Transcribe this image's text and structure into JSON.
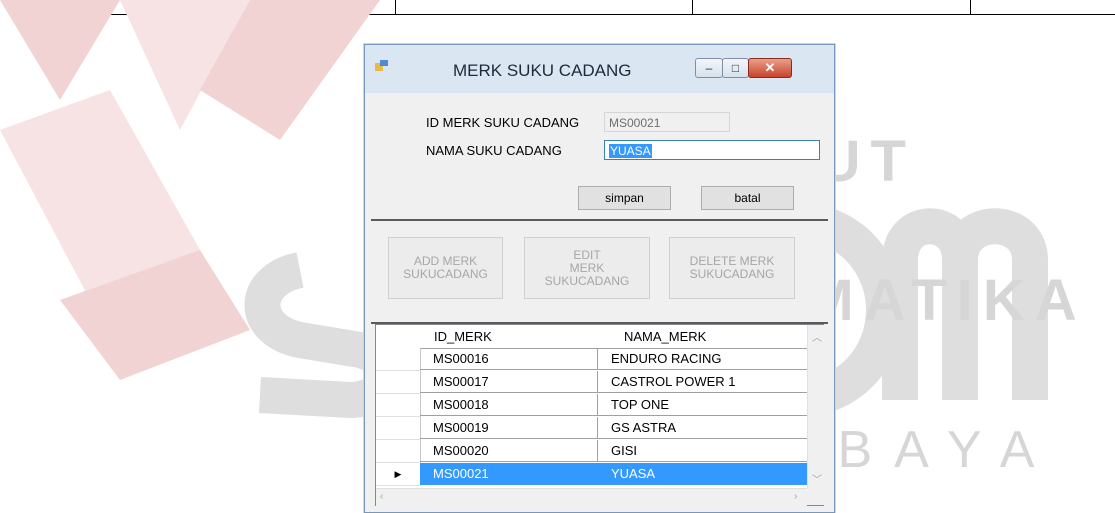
{
  "watermark": {
    "line1": "INSTITUT BISNIS",
    "line2": "& INFORMATIKA",
    "line3": "SURABAYA",
    "brand": "stikom"
  },
  "window": {
    "title": "MERK SUKU CADANG",
    "minimize_glyph": "–",
    "maximize_glyph": "□",
    "close_glyph": "✕"
  },
  "form": {
    "id_label": "ID MERK SUKU CADANG",
    "id_value": "MS00021",
    "name_label": "NAMA SUKU CADANG",
    "name_value": "YUASA",
    "save_label": "simpan",
    "cancel_label": "batal"
  },
  "actions": {
    "add_label": "ADD MERK\nSUKUCADANG",
    "edit_label": "EDIT\nMERK\nSUKUCADANG",
    "delete_label": "DELETE MERK\nSUKUCADANG"
  },
  "grid": {
    "columns": [
      "ID_MERK",
      "NAMA_MERK"
    ],
    "rows": [
      {
        "id": "MS00016",
        "name": "ENDURO RACING",
        "selected": false
      },
      {
        "id": "MS00017",
        "name": "CASTROL POWER 1",
        "selected": false
      },
      {
        "id": "MS00018",
        "name": "TOP ONE",
        "selected": false
      },
      {
        "id": "MS00019",
        "name": "GS ASTRA",
        "selected": false
      },
      {
        "id": "MS00020",
        "name": "GISI",
        "selected": false
      },
      {
        "id": "MS00021",
        "name": "YUASA",
        "selected": true
      }
    ],
    "current_row_marker": "▶"
  },
  "colors": {
    "selection": "#3399ff",
    "watermark_red": "#e8b9b9"
  }
}
